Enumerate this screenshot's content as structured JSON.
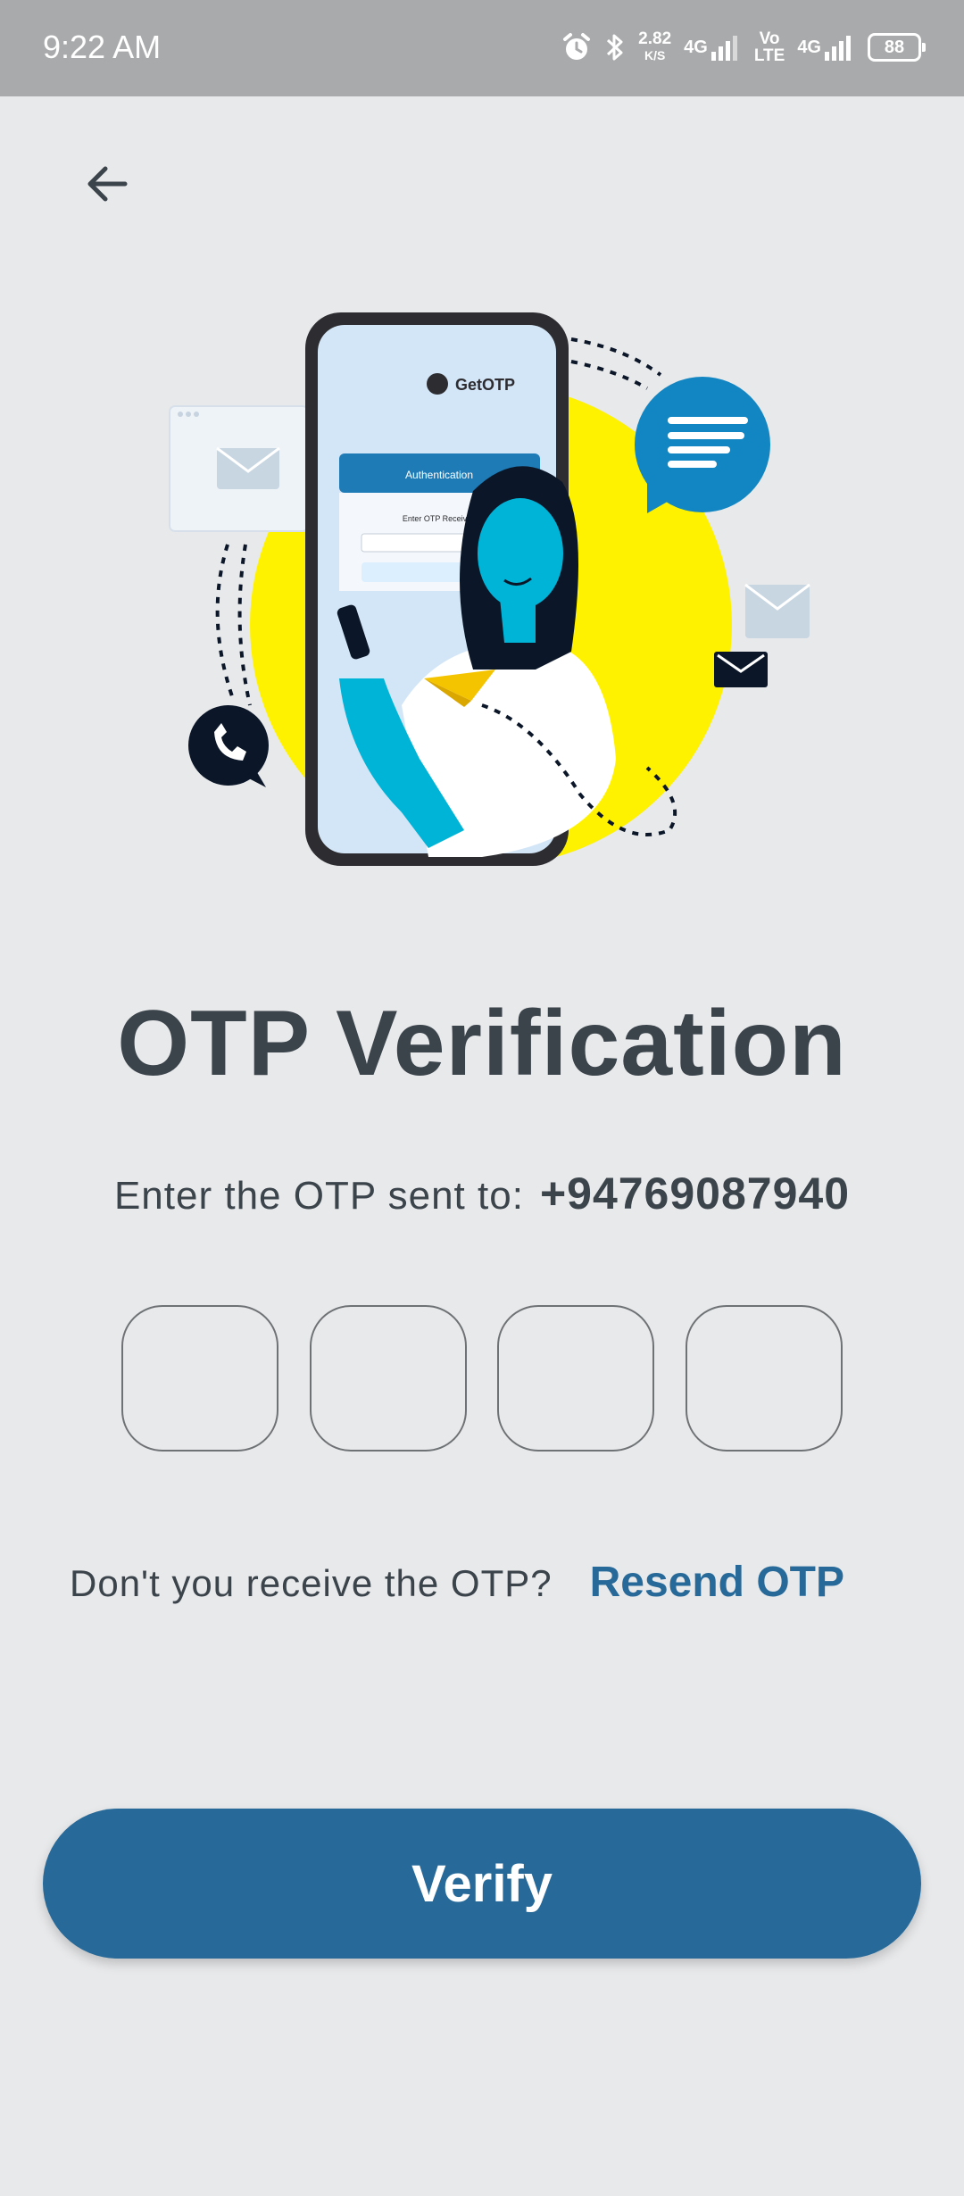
{
  "status_bar": {
    "time": "9:22 AM",
    "speed_value": "2.82",
    "speed_unit": "K/S",
    "network_1": "4G",
    "volte_top": "Vo",
    "volte_bottom": "LTE",
    "network_2": "4G",
    "battery": "88"
  },
  "illustration": {
    "brand": "GetOTP",
    "card_title": "Authentication",
    "card_field_label": "Enter OTP Received"
  },
  "page": {
    "title": "OTP Verification",
    "sent_label": "Enter the OTP sent to:",
    "phone_number": "+94769087940",
    "otp_digits": [
      "",
      "",
      "",
      ""
    ],
    "resend_question": "Don't you receive the OTP?",
    "resend_link": "Resend OTP",
    "verify_label": "Verify"
  },
  "colors": {
    "background": "#e8e9eb",
    "status_bar": "#a9aaab",
    "primary": "#276a99",
    "text": "#3b434b",
    "accent_yellow": "#fff200",
    "accent_cyan": "#00b4d8"
  }
}
